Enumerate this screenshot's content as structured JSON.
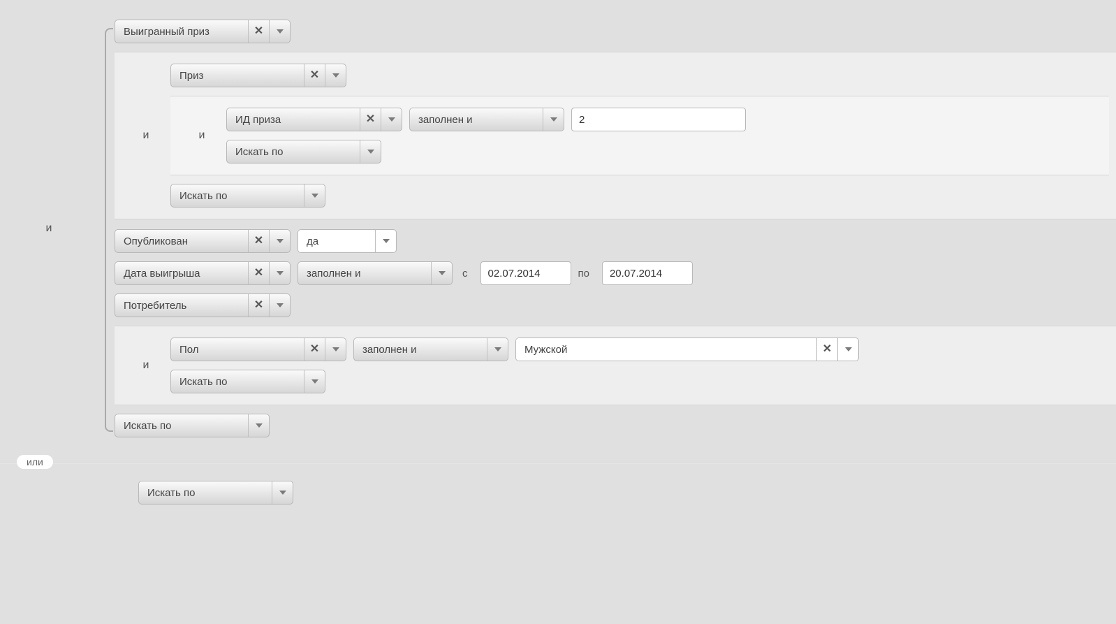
{
  "ops": {
    "and": "и",
    "or": "или"
  },
  "search_by": "Искать по",
  "top": {
    "won_prize": "Выигранный приз",
    "prize": "Приз",
    "prize_id": "ИД приза",
    "filled_and": "заполнен и",
    "value_2": "2",
    "published": "Опубликован",
    "yes": "да",
    "win_date": "Дата выигрыша",
    "from_label": "с",
    "to_label": "по",
    "date_from": "02.07.2014",
    "date_to": "20.07.2014",
    "consumer": "Потребитель",
    "gender": "Пол",
    "male": "Мужской"
  }
}
